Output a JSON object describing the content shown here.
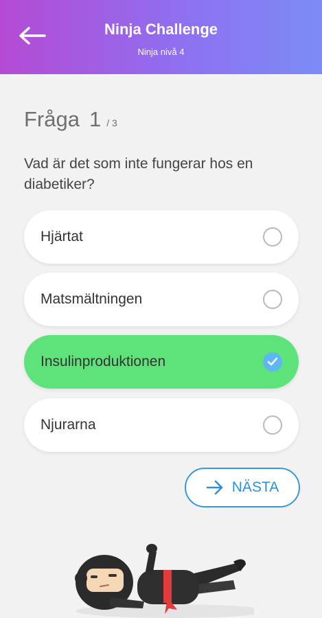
{
  "header": {
    "title": "Ninja Challenge",
    "subtitle": "Ninja nivå 4"
  },
  "question": {
    "label": "Fråga",
    "number": "1",
    "total": "/ 3",
    "text": "Vad är det som inte fungerar hos en diabetiker?"
  },
  "options": [
    {
      "label": "Hjärtat",
      "selected": false
    },
    {
      "label": "Matsmältningen",
      "selected": false
    },
    {
      "label": "Insulinproduktionen",
      "selected": true
    },
    {
      "label": "Njurarna",
      "selected": false
    }
  ],
  "next_button": {
    "label": "NÄSTA"
  },
  "colors": {
    "header_gradient_start": "#b54ad4",
    "header_gradient_end": "#7b8cf7",
    "selected_option": "#5ee37b",
    "accent_blue": "#3598e3"
  },
  "icons": {
    "back": "arrow-left-icon",
    "next": "arrow-right-icon",
    "check": "check-icon"
  }
}
